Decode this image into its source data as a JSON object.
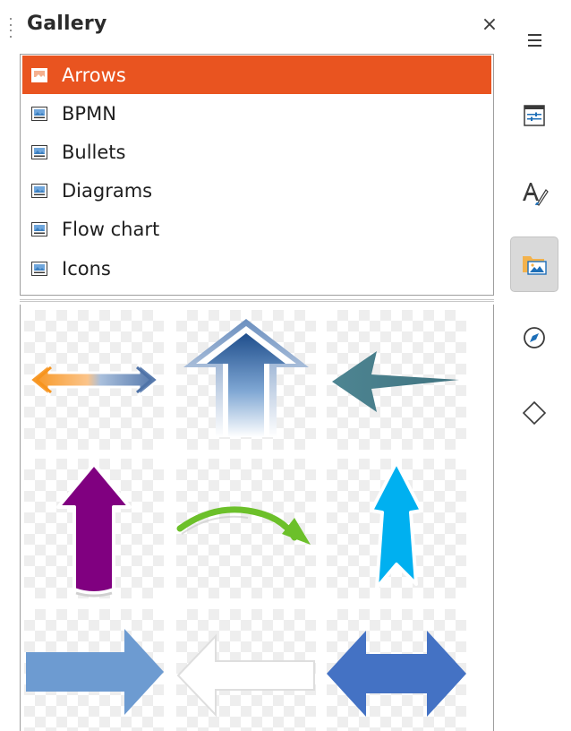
{
  "deck": {
    "title": "Gallery",
    "close_glyph": "×"
  },
  "themes": {
    "selected_index": 0,
    "items": [
      {
        "label": "Arrows",
        "icon": "gallery-theme-icon"
      },
      {
        "label": "BPMN",
        "icon": "gallery-theme-icon"
      },
      {
        "label": "Bullets",
        "icon": "gallery-theme-icon"
      },
      {
        "label": "Diagrams",
        "icon": "gallery-theme-icon"
      },
      {
        "label": "Flow chart",
        "icon": "gallery-theme-icon"
      },
      {
        "label": "Icons",
        "icon": "gallery-theme-icon"
      }
    ]
  },
  "gallery": {
    "items": [
      {
        "name": "double-arrow-orange-blue",
        "colors": [
          "#f7941d",
          "#5b7fb5"
        ]
      },
      {
        "name": "up-arrow-gradient-blue",
        "colors": [
          "#1f4e8c",
          "#cfe0f3"
        ]
      },
      {
        "name": "left-arrow-teal",
        "colors": [
          "#4a8a98"
        ]
      },
      {
        "name": "up-arrow-purple",
        "colors": [
          "#800080"
        ]
      },
      {
        "name": "curved-arrow-green",
        "colors": [
          "#6cc02a"
        ]
      },
      {
        "name": "up-arrow-cyan",
        "colors": [
          "#00b0f0"
        ]
      },
      {
        "name": "right-arrow-steel-blue",
        "colors": [
          "#6d9bd1"
        ]
      },
      {
        "name": "left-arrow-white-outline",
        "colors": [
          "#ffffff",
          "#d8d8d8"
        ]
      },
      {
        "name": "double-arrow-royal-blue",
        "colors": [
          "#4472c4"
        ]
      }
    ]
  },
  "tabbar": {
    "active_index": 3,
    "tabs": [
      {
        "icon": "hamburger-menu-icon"
      },
      {
        "icon": "properties-icon"
      },
      {
        "icon": "styles-icon"
      },
      {
        "icon": "gallery-icon"
      },
      {
        "icon": "navigator-icon"
      },
      {
        "icon": "shapes-icon"
      }
    ]
  },
  "colors": {
    "selection": "#e95420",
    "border": "#9e9e9e"
  }
}
